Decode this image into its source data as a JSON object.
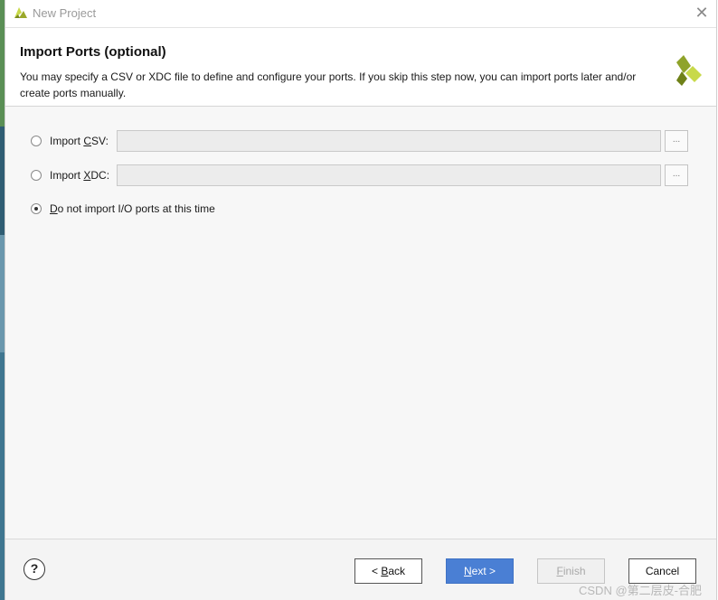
{
  "window": {
    "title": "New Project",
    "close_icon": "close-icon"
  },
  "header": {
    "title": "Import Ports (optional)",
    "description": "You may specify a CSV or XDC file to define and configure your ports. If you skip this step now, you can import ports later and/or create ports manually."
  },
  "options": [
    {
      "pre": "Import ",
      "accel": "C",
      "post": "SV:",
      "value": "",
      "browse": "...",
      "selected": false
    },
    {
      "pre": "Import ",
      "accel": "X",
      "post": "DC:",
      "value": "",
      "browse": "...",
      "selected": false
    },
    {
      "pre": "",
      "accel": "D",
      "post": "o not import I/O ports at this time",
      "selected": true
    }
  ],
  "footer": {
    "help": "?",
    "back": {
      "pre": "< ",
      "accel": "B",
      "post": "ack"
    },
    "next": {
      "pre": "",
      "accel": "N",
      "post": "ext >"
    },
    "finish": {
      "pre": "",
      "accel": "F",
      "post": "inish",
      "enabled": false
    },
    "cancel": "Cancel"
  },
  "watermark": "CSDN @第二层皮-合肥",
  "colors": {
    "accent": "#4a7fd4",
    "logo_light": "#c8d94a",
    "logo_dark": "#7a8a1e"
  }
}
